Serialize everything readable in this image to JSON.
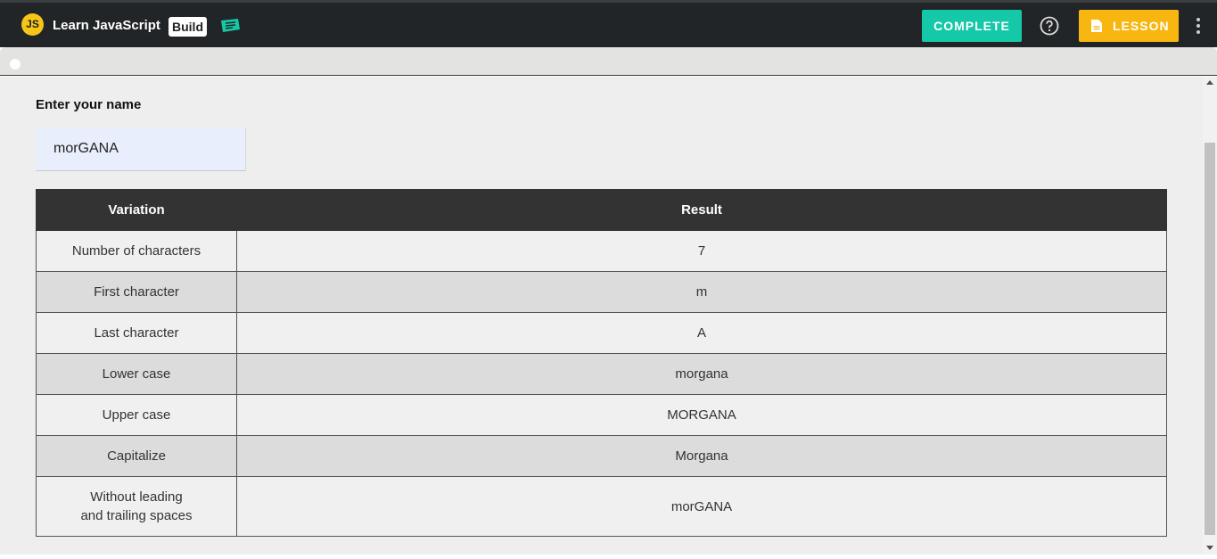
{
  "header": {
    "logo_text": "JS",
    "app_title": "Learn JavaScript",
    "badge": "Build",
    "ticket_icon": "ticket-icon",
    "complete_label": "COMPLETE",
    "help_icon": "question-circle-icon",
    "lesson_label": "LESSON",
    "lesson_icon": "document-icon",
    "more_icon": "vertical-ellipsis-icon",
    "colors": {
      "complete": "#14c8a8",
      "lesson": "#f8b611",
      "logo": "#f5c518"
    }
  },
  "form": {
    "label": "Enter your name",
    "value": "morGANA"
  },
  "table": {
    "headers": [
      "Variation",
      "Result"
    ],
    "rows": [
      {
        "variation": "Number of characters",
        "result": "7"
      },
      {
        "variation": "First character",
        "result": "m"
      },
      {
        "variation": "Last character",
        "result": "A"
      },
      {
        "variation": "Lower case",
        "result": "morgana"
      },
      {
        "variation": "Upper case",
        "result": "MORGANA"
      },
      {
        "variation": "Capitalize",
        "result": "Morgana"
      },
      {
        "variation_line1": "Without leading",
        "variation_line2": "and trailing spaces",
        "result": "morGANA"
      }
    ]
  }
}
